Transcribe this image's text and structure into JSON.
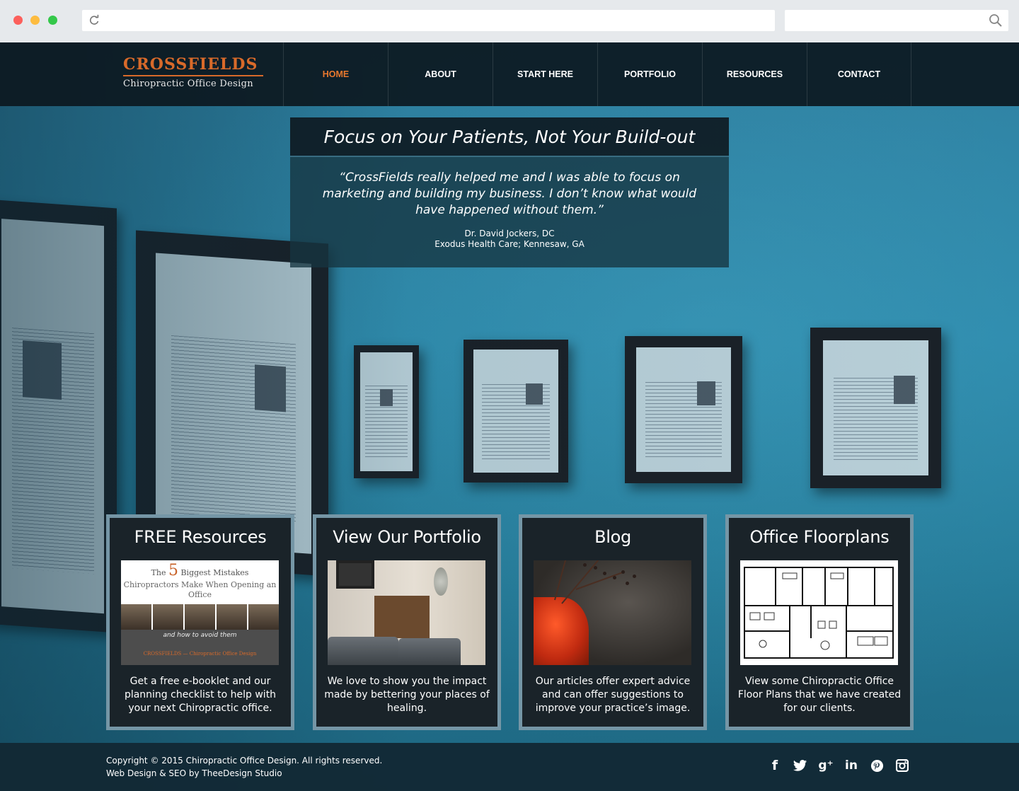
{
  "browser": {
    "url": "",
    "search": ""
  },
  "logo": {
    "title": "CROSSFIELDS",
    "subtitle": "Chiropractic Office Design"
  },
  "nav": {
    "items": [
      {
        "label": "HOME",
        "active": true
      },
      {
        "label": "ABOUT",
        "active": false
      },
      {
        "label": "START HERE",
        "active": false
      },
      {
        "label": "PORTFOLIO",
        "active": false
      },
      {
        "label": "RESOURCES",
        "active": false
      },
      {
        "label": "CONTACT",
        "active": false
      }
    ]
  },
  "testimonial": {
    "heading": "Focus on Your Patients, Not Your Build-out",
    "quote": "“CrossFields really helped me and I was able to focus on marketing and building my business. I don’t know what would have happened without them.”",
    "author": "Dr. David Jockers, DC",
    "clinic": "Exodus Health Care; Kennesaw, GA"
  },
  "cards": [
    {
      "title": "FREE Resources",
      "text": "Get a free e-booklet and our planning checklist to help with your next Chiropractic office.",
      "image": {
        "line1_pre": "The",
        "line1_num": "5",
        "line1_post": "Biggest Mistakes",
        "line2": "Chiropractors Make When Opening an Office",
        "line3": "and how to avoid them",
        "brand": "CROSSFIELDS — Chiropractic Office Design"
      }
    },
    {
      "title": "View Our Portfolio",
      "text": "We love to show you the impact made by bettering your places of healing."
    },
    {
      "title": "Blog",
      "text": "Our articles offer expert advice and can offer suggestions to improve your practice’s image."
    },
    {
      "title": "Office Floorplans",
      "text": "View some Chiropractic Office Floor Plans that we have created for our clients."
    }
  ],
  "footer": {
    "copyright": "Copyright © 2015 Chiropractic Office Design. All rights reserved.",
    "credit": "Web Design & SEO by TheeDesign Studio"
  },
  "social": [
    "facebook-icon",
    "twitter-icon",
    "google-plus-icon",
    "linkedin-icon",
    "pinterest-icon",
    "instagram-icon"
  ],
  "colors": {
    "accent": "#e8782e",
    "nav_bg": "#0c1820",
    "card_border": "#7596a6"
  }
}
